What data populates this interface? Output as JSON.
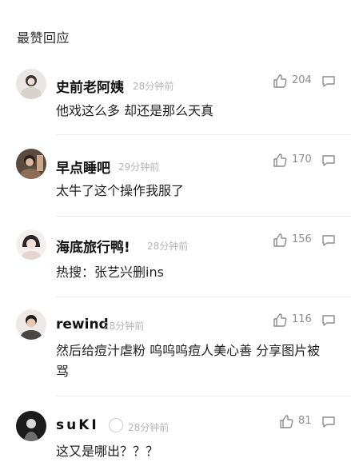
{
  "section": {
    "title": "最赞回应"
  },
  "comments": [
    {
      "name": "史前老阿姨",
      "time": "28分钟前",
      "likes": "204",
      "text": "他戏这么多 却还是那么天真"
    },
    {
      "name": "早点睡吧",
      "time": "29分钟前",
      "likes": "170",
      "text": "太牛了这个操作我服了"
    },
    {
      "name": "海底旅行鸭!",
      "time": "28分钟前",
      "likes": "156",
      "text": "热搜：张艺兴删ins"
    },
    {
      "name": "rewind",
      "time": "28分钟前",
      "likes": "116",
      "text": "然后给痘汁虐粉 呜呜呜痘人美心善 分享图片被骂"
    },
    {
      "name": "suKI",
      "time": "28分钟前",
      "likes": "81",
      "text": "这又是哪出？？？"
    }
  ],
  "colors": {
    "text": "#1a1a1a",
    "meta": "#b5b5b5",
    "count": "#8c8c8c",
    "divider": "#ececec"
  },
  "icons": {
    "like": "thumbs-up-icon",
    "reply": "comment-bubble-icon"
  }
}
